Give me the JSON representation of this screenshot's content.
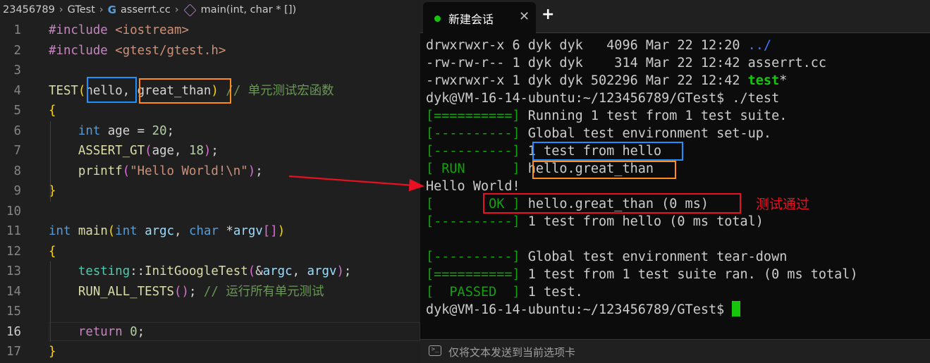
{
  "breadcrumb": {
    "items": [
      "23456789",
      "GTest",
      "asserrt.cc",
      "main(int, char * [])"
    ],
    "icons": [
      "chevron-right-icon",
      "cpp-file-icon",
      "cube-symbol-icon"
    ]
  },
  "editor": {
    "current_line": "16",
    "lines": [
      {
        "num": "1",
        "tokens": [
          [
            "kw-pp",
            "#include"
          ],
          [
            "",
            " "
          ],
          [
            "str",
            "<iostream>"
          ]
        ]
      },
      {
        "num": "2",
        "tokens": [
          [
            "kw-pp",
            "#include"
          ],
          [
            "",
            " "
          ],
          [
            "str",
            "<gtest/gtest.h>"
          ]
        ]
      },
      {
        "num": "3",
        "tokens": []
      },
      {
        "num": "4",
        "tokens": [
          [
            "fn",
            "TEST"
          ],
          [
            "br1",
            "("
          ],
          [
            "",
            "hello, great_than"
          ],
          [
            "br1",
            ")"
          ],
          [
            "",
            " "
          ],
          [
            "cm",
            "// 单元测试宏函数"
          ]
        ]
      },
      {
        "num": "5",
        "tokens": [
          [
            "br1",
            "{"
          ]
        ]
      },
      {
        "num": "6",
        "tokens": [
          [
            "",
            "    "
          ],
          [
            "kw",
            "int"
          ],
          [
            "",
            " age = "
          ],
          [
            "num",
            "20"
          ],
          [
            "",
            ";"
          ]
        ]
      },
      {
        "num": "7",
        "tokens": [
          [
            "",
            "    "
          ],
          [
            "fn",
            "ASSERT_GT"
          ],
          [
            "br2",
            "("
          ],
          [
            "",
            "age, "
          ],
          [
            "num",
            "18"
          ],
          [
            "br2",
            ")"
          ],
          [
            "",
            ";"
          ]
        ]
      },
      {
        "num": "8",
        "tokens": [
          [
            "",
            "    "
          ],
          [
            "fn",
            "printf"
          ],
          [
            "br2",
            "("
          ],
          [
            "str",
            "\"Hello World!\\n\""
          ],
          [
            "br2",
            ")"
          ],
          [
            "",
            ";"
          ]
        ]
      },
      {
        "num": "9",
        "tokens": [
          [
            "br1",
            "}"
          ]
        ]
      },
      {
        "num": "10",
        "tokens": []
      },
      {
        "num": "11",
        "tokens": [
          [
            "kw",
            "int"
          ],
          [
            "",
            " "
          ],
          [
            "fn",
            "main"
          ],
          [
            "br1",
            "("
          ],
          [
            "kw",
            "int"
          ],
          [
            "",
            " "
          ],
          [
            "var",
            "argc"
          ],
          [
            "",
            ", "
          ],
          [
            "kw",
            "char"
          ],
          [
            "",
            " *"
          ],
          [
            "var",
            "argv"
          ],
          [
            "br2",
            "[]"
          ],
          [
            "br1",
            ")"
          ]
        ]
      },
      {
        "num": "12",
        "tokens": [
          [
            "br1",
            "{"
          ]
        ]
      },
      {
        "num": "13",
        "tokens": [
          [
            "",
            "    "
          ],
          [
            "typ",
            "testing"
          ],
          [
            "",
            "::"
          ],
          [
            "fn",
            "InitGoogleTest"
          ],
          [
            "br2",
            "("
          ],
          [
            "",
            "&"
          ],
          [
            "var",
            "argc"
          ],
          [
            "",
            ", "
          ],
          [
            "var",
            "argv"
          ],
          [
            "br2",
            ")"
          ],
          [
            "",
            ";"
          ]
        ]
      },
      {
        "num": "14",
        "tokens": [
          [
            "",
            "    "
          ],
          [
            "fn",
            "RUN_ALL_TESTS"
          ],
          [
            "br2",
            "()"
          ],
          [
            "",
            "; "
          ],
          [
            "cm",
            "// 运行所有单元测试"
          ]
        ]
      },
      {
        "num": "15",
        "tokens": []
      },
      {
        "num": "16",
        "tokens": [
          [
            "",
            "    "
          ],
          [
            "ctl",
            "return"
          ],
          [
            "",
            " "
          ],
          [
            "num",
            "0"
          ],
          [
            "",
            ";"
          ]
        ]
      },
      {
        "num": "17",
        "tokens": [
          [
            "br1",
            "}"
          ]
        ]
      }
    ]
  },
  "terminal": {
    "tab_title": "新建会话",
    "tab_close": "✕",
    "new_tab": "+",
    "lines": [
      [
        [
          "",
          "drwxrwxr-x 6 dyk dyk   4096 Mar 22 12:20 "
        ],
        [
          "b",
          "../"
        ]
      ],
      [
        [
          "",
          "-rw-rw-r-- 1 dyk dyk    314 Mar 22 12:42 asserrt.cc"
        ]
      ],
      [
        [
          "",
          "-rwxrwxr-x 1 dyk dyk 502296 Mar 22 12:42 "
        ],
        [
          "bg",
          "test"
        ],
        [
          "",
          "*"
        ]
      ],
      [
        [
          "",
          "dyk@VM-16-14-ubuntu:~/123456789/GTest$ ./test"
        ]
      ],
      [
        [
          "g",
          "[==========]"
        ],
        [
          "",
          " Running 1 test from 1 test suite."
        ]
      ],
      [
        [
          "g",
          "[----------]"
        ],
        [
          "",
          " Global test environment set-up."
        ]
      ],
      [
        [
          "g",
          "[----------]"
        ],
        [
          "",
          " 1 test from hello"
        ]
      ],
      [
        [
          "g",
          "[ RUN      ]"
        ],
        [
          "",
          " hello.great_than"
        ]
      ],
      [
        [
          "",
          "Hello World!"
        ]
      ],
      [
        [
          "g",
          "[       OK ]"
        ],
        [
          "",
          " hello.great_than (0 ms)"
        ]
      ],
      [
        [
          "g",
          "[----------]"
        ],
        [
          "",
          " 1 test from hello (0 ms total)"
        ]
      ],
      [
        [
          "",
          ""
        ]
      ],
      [
        [
          "g",
          "[----------]"
        ],
        [
          "",
          " Global test environment tear-down"
        ]
      ],
      [
        [
          "g",
          "[==========]"
        ],
        [
          "",
          " 1 test from 1 test suite ran. (0 ms total)"
        ]
      ],
      [
        [
          "g",
          "[  PASSED  ]"
        ],
        [
          "",
          " 1 test."
        ]
      ],
      [
        [
          "",
          "dyk@VM-16-14-ubuntu:~/123456789/GTest$ "
        ]
      ]
    ],
    "status_text": "仅将文本发送到当前选项卡"
  },
  "annotation": {
    "label": "测试通过",
    "colors": {
      "blue": "#1e90ff",
      "orange": "#ff8c1a",
      "red": "#e81123"
    }
  }
}
